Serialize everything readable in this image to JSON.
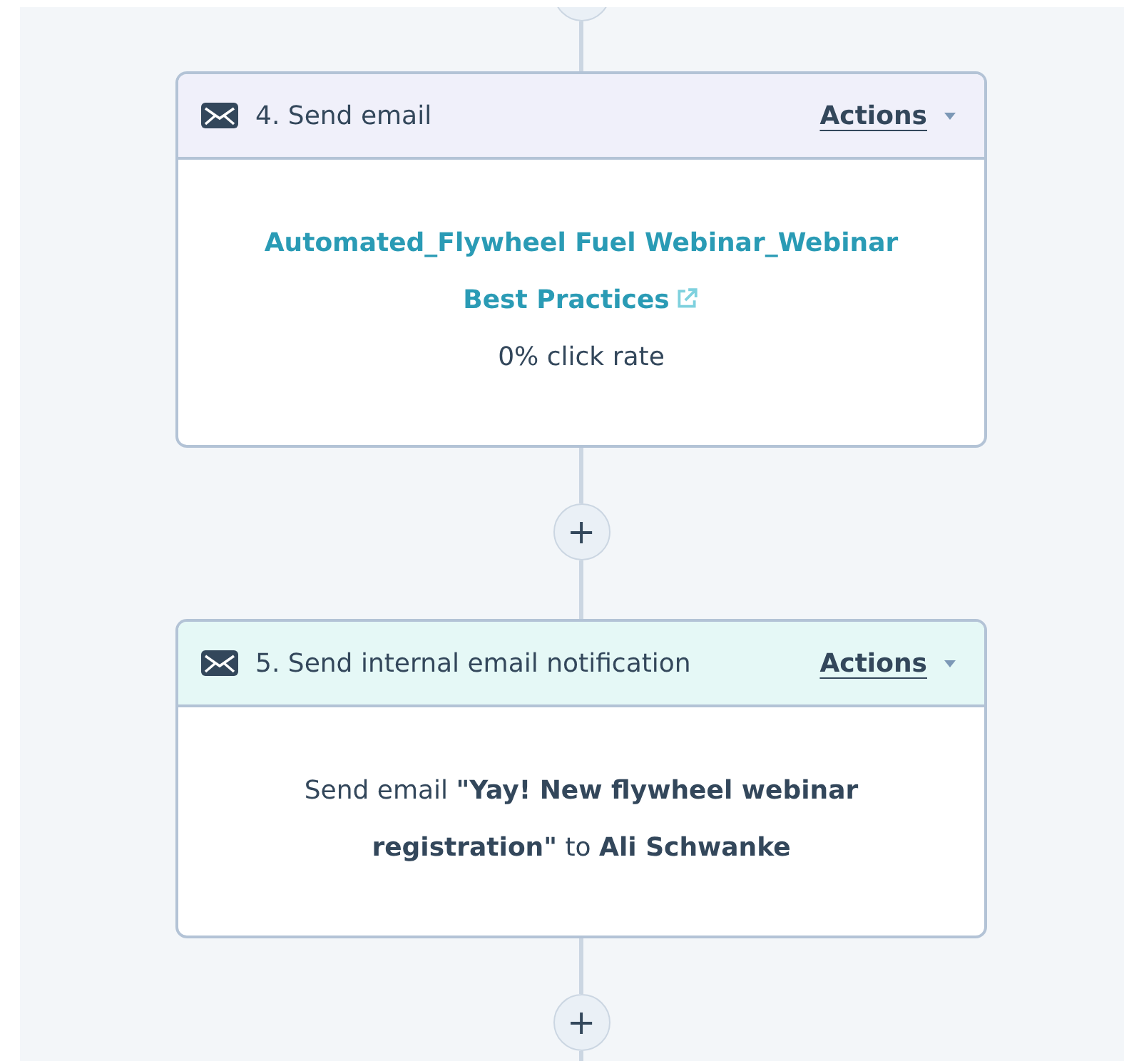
{
  "steps": [
    {
      "kind": "email",
      "title": "4. Send email",
      "actions": "Actions",
      "link": "Automated_Flywheel Fuel Webinar_Webinar Best Practices",
      "stat": "0% click rate"
    },
    {
      "kind": "internal",
      "title": "5. Send internal email notification",
      "actions": "Actions",
      "description": "Send email **\"Yay! New flywheel webinar registration\"** to **Ali Schwanke**"
    }
  ],
  "add_buttons": [
    "+",
    "+"
  ]
}
